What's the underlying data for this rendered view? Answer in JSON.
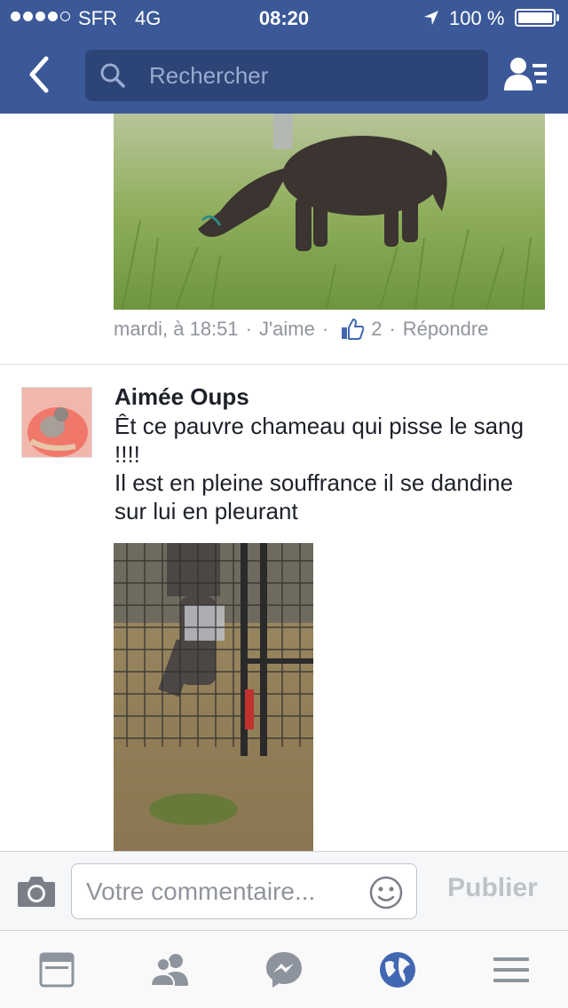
{
  "status_bar": {
    "carrier": "SFR",
    "network": "4G",
    "time": "08:20",
    "battery_percent": "100 %",
    "battery_level": 1.0,
    "signal_bars_filled": 4,
    "signal_bars_total": 5
  },
  "nav": {
    "back_icon": "chevron-left-icon",
    "search_placeholder": "Rechercher",
    "friend_requests_icon": "friend-requests-icon"
  },
  "post1": {
    "image": "pony-grazing-photo",
    "time": "mardi, à 18:51",
    "sep1": "·",
    "like_label": "J'aime",
    "sep2": "·",
    "like_count": "2",
    "sep3": "·",
    "reply_label": "Répondre"
  },
  "post2": {
    "author": "Aimée Oups",
    "text_line1": "Êt ce pauvre chameau qui pisse le sang !!!!",
    "text_line2": "Il est en pleine souffrance il se dandine sur lui en pleurant",
    "image": "camel-in-cage-photo"
  },
  "composer": {
    "placeholder": "Votre commentaire...",
    "publish_label": "Publier"
  },
  "tabs": [
    {
      "icon": "news-feed-icon",
      "active": false
    },
    {
      "icon": "friends-icon",
      "active": false
    },
    {
      "icon": "messenger-icon",
      "active": false
    },
    {
      "icon": "notifications-globe-icon",
      "active": true
    },
    {
      "icon": "menu-icon",
      "active": false
    }
  ],
  "colors": {
    "brand": "#3b5998",
    "active_tab": "#4267b2",
    "inactive_tab": "#8d949e",
    "meta_text": "#90949c"
  }
}
